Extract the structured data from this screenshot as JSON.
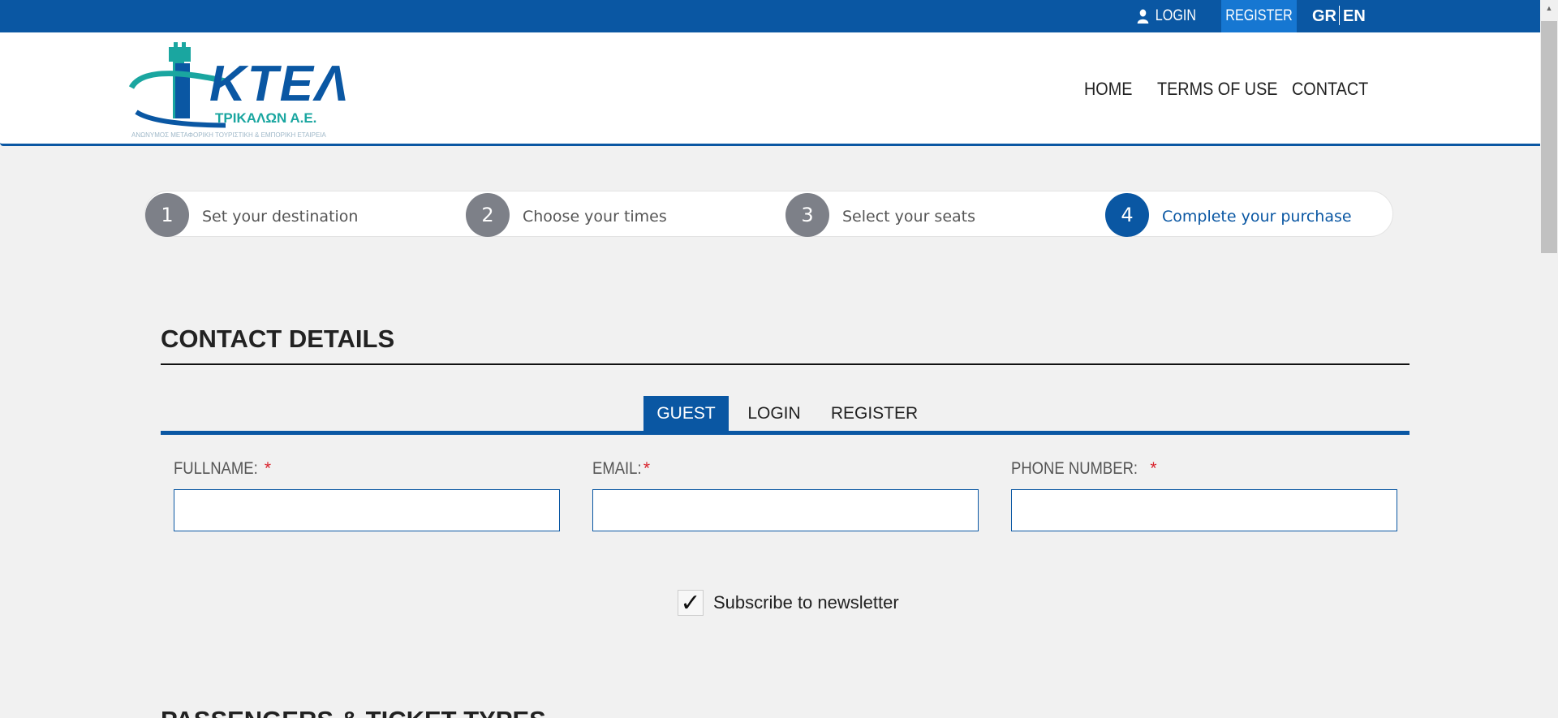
{
  "topbar": {
    "login_label": "LOGIN",
    "register_label": "REGISTER",
    "lang_gr": "GR",
    "lang_en": "EN"
  },
  "header": {
    "logo_title": "KTEΛ",
    "logo_subtitle": "ΤΡΙΚΑΛΩΝ Α.Ε.",
    "logo_tagline": "ΑΝΩΝΥΜΟΣ ΜΕΤΑΦΟΡΙΚΗ ΤΟΥΡΙΣΤΙΚΗ & ΕΜΠΟΡΙΚΗ ΕΤΑΙΡΕΙΑ",
    "nav": {
      "home": "HOME",
      "terms": "TERMS OF USE",
      "contact": "CONTACT"
    }
  },
  "steps": [
    {
      "num": "1",
      "label": "Set your destination"
    },
    {
      "num": "2",
      "label": "Choose your times"
    },
    {
      "num": "3",
      "label": "Select your seats"
    },
    {
      "num": "4",
      "label": "Complete your purchase"
    }
  ],
  "contact": {
    "title": "CONTACT DETAILS",
    "tabs": {
      "guest": "GUEST",
      "login": "LOGIN",
      "register": "REGISTER"
    },
    "fields": {
      "fullname_label": "FULLNAME:",
      "email_label": "EMAIL:",
      "phone_label": "PHONE NUMBER:",
      "required_mark": "*",
      "fullname_value": "",
      "email_value": "",
      "phone_value": ""
    },
    "newsletter_label": "Subscribe to newsletter",
    "newsletter_check": "✓"
  },
  "next_section_title": "PASSENGERS & TICKET TYPES",
  "colors": {
    "primary": "#0a57a3",
    "register_bg": "#1677d2",
    "step_inactive": "#7d8088",
    "required": "#d9232d",
    "logo_teal": "#1aa6a0"
  }
}
